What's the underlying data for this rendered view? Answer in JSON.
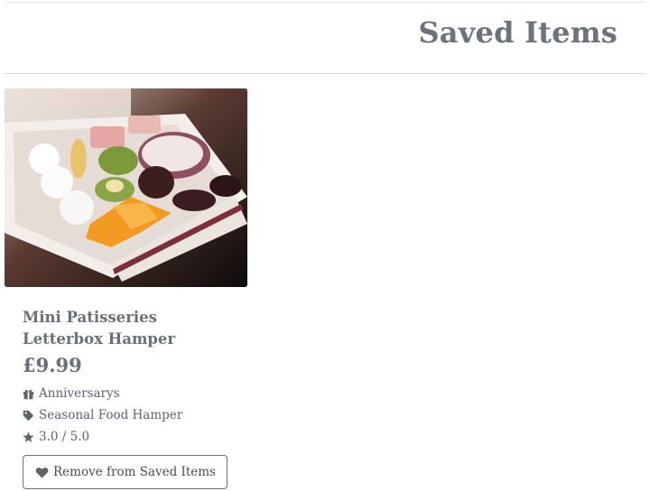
{
  "header": {
    "title": "Saved Items"
  },
  "items": [
    {
      "title": "Mini Patisseries Letterbox Hamper",
      "price": "£9.99",
      "occasion": "Anniversarys",
      "category": "Seasonal Food Hamper",
      "rating": "3.0 / 5.0",
      "image_icon": "product-photo-patisseries-box",
      "occasion_icon": "gift-icon",
      "category_icon": "tag-icon",
      "rating_icon": "star-icon",
      "remove_label": "Remove from Saved Items",
      "remove_icon": "heart-icon"
    }
  ]
}
